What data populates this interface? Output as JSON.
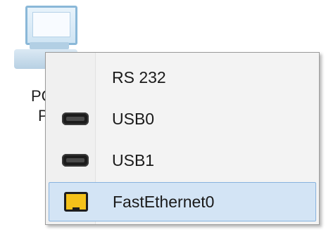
{
  "device": {
    "label_line1": "PC",
    "label_line2": "P",
    "icon": "desktop-pc-icon"
  },
  "menu": {
    "items": [
      {
        "label": "RS 232",
        "icon": "none"
      },
      {
        "label": "USB0",
        "icon": "usb-port-icon"
      },
      {
        "label": "USB1",
        "icon": "usb-port-icon"
      },
      {
        "label": "FastEthernet0",
        "icon": "ethernet-port-icon",
        "highlighted": true
      }
    ]
  },
  "colors": {
    "highlight_bg": "#d3e4f5",
    "highlight_border": "#88b3de",
    "ethernet_icon": "#f5c21a"
  }
}
